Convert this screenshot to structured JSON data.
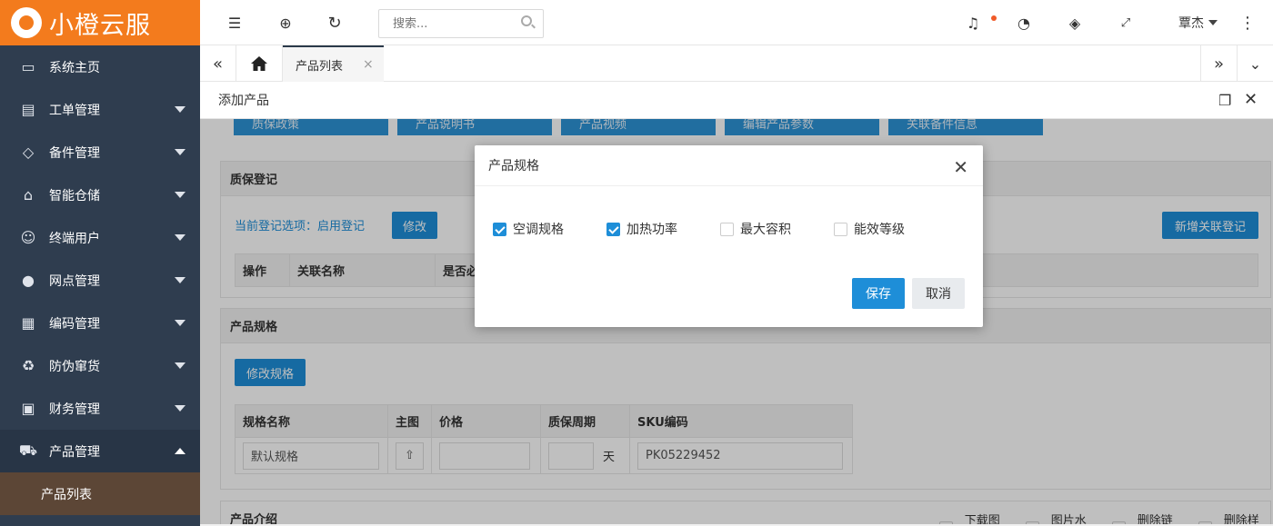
{
  "app": {
    "name": "小橙云服"
  },
  "sidebar": {
    "items": [
      {
        "label": "系统主页",
        "icon": "monitor-icon"
      },
      {
        "label": "工单管理",
        "icon": "document-icon"
      },
      {
        "label": "备件管理",
        "icon": "diamond-link-icon"
      },
      {
        "label": "智能仓储",
        "icon": "bank-icon"
      },
      {
        "label": "终端用户",
        "icon": "user-icon"
      },
      {
        "label": "网点管理",
        "icon": "globe-icon"
      },
      {
        "label": "编码管理",
        "icon": "grid-icon"
      },
      {
        "label": "防伪窜货",
        "icon": "recycle-icon"
      },
      {
        "label": "财务管理",
        "icon": "money-icon"
      },
      {
        "label": "产品管理",
        "icon": "cart-icon"
      }
    ],
    "sub_item": "产品列表"
  },
  "topbar": {
    "search_placeholder": "搜索...",
    "user": "覃杰"
  },
  "tabs": {
    "active": "产品列表"
  },
  "page": {
    "title": "添加产品"
  },
  "content": {
    "top_buttons": [
      "质保政策",
      "产品说明书",
      "产品视频",
      "编辑产品参数",
      "关联备件信息"
    ],
    "warranty": {
      "title": "质保登记",
      "note": "当前登记选项：启用登记",
      "modify": "修改",
      "add_btn": "新增关联登记",
      "headers": [
        "操作",
        "关联名称",
        "是否必"
      ]
    },
    "spec": {
      "title": "产品规格",
      "modify_btn": "修改规格",
      "headers": [
        "规格名称",
        "主图",
        "价格",
        "质保周期",
        "SKU编码"
      ],
      "row": {
        "name": "默认规格",
        "unit": "天",
        "sku": "PK05229452"
      }
    },
    "intro": {
      "title": "产品介绍",
      "options": [
        "下载图片",
        "图片水印",
        "删除链接",
        "删除样式"
      ]
    }
  },
  "modal": {
    "title": "产品规格",
    "options": [
      {
        "label": "空调规格",
        "checked": true
      },
      {
        "label": "加热功率",
        "checked": true
      },
      {
        "label": "最大容积",
        "checked": false
      },
      {
        "label": "能效等级",
        "checked": false
      }
    ],
    "save": "保存",
    "cancel": "取消"
  },
  "colors": {
    "brand": "#f37b1d",
    "sidebar": "#2f3d4f",
    "primary": "#1e8ed8",
    "active_sub": "#5c4636"
  }
}
